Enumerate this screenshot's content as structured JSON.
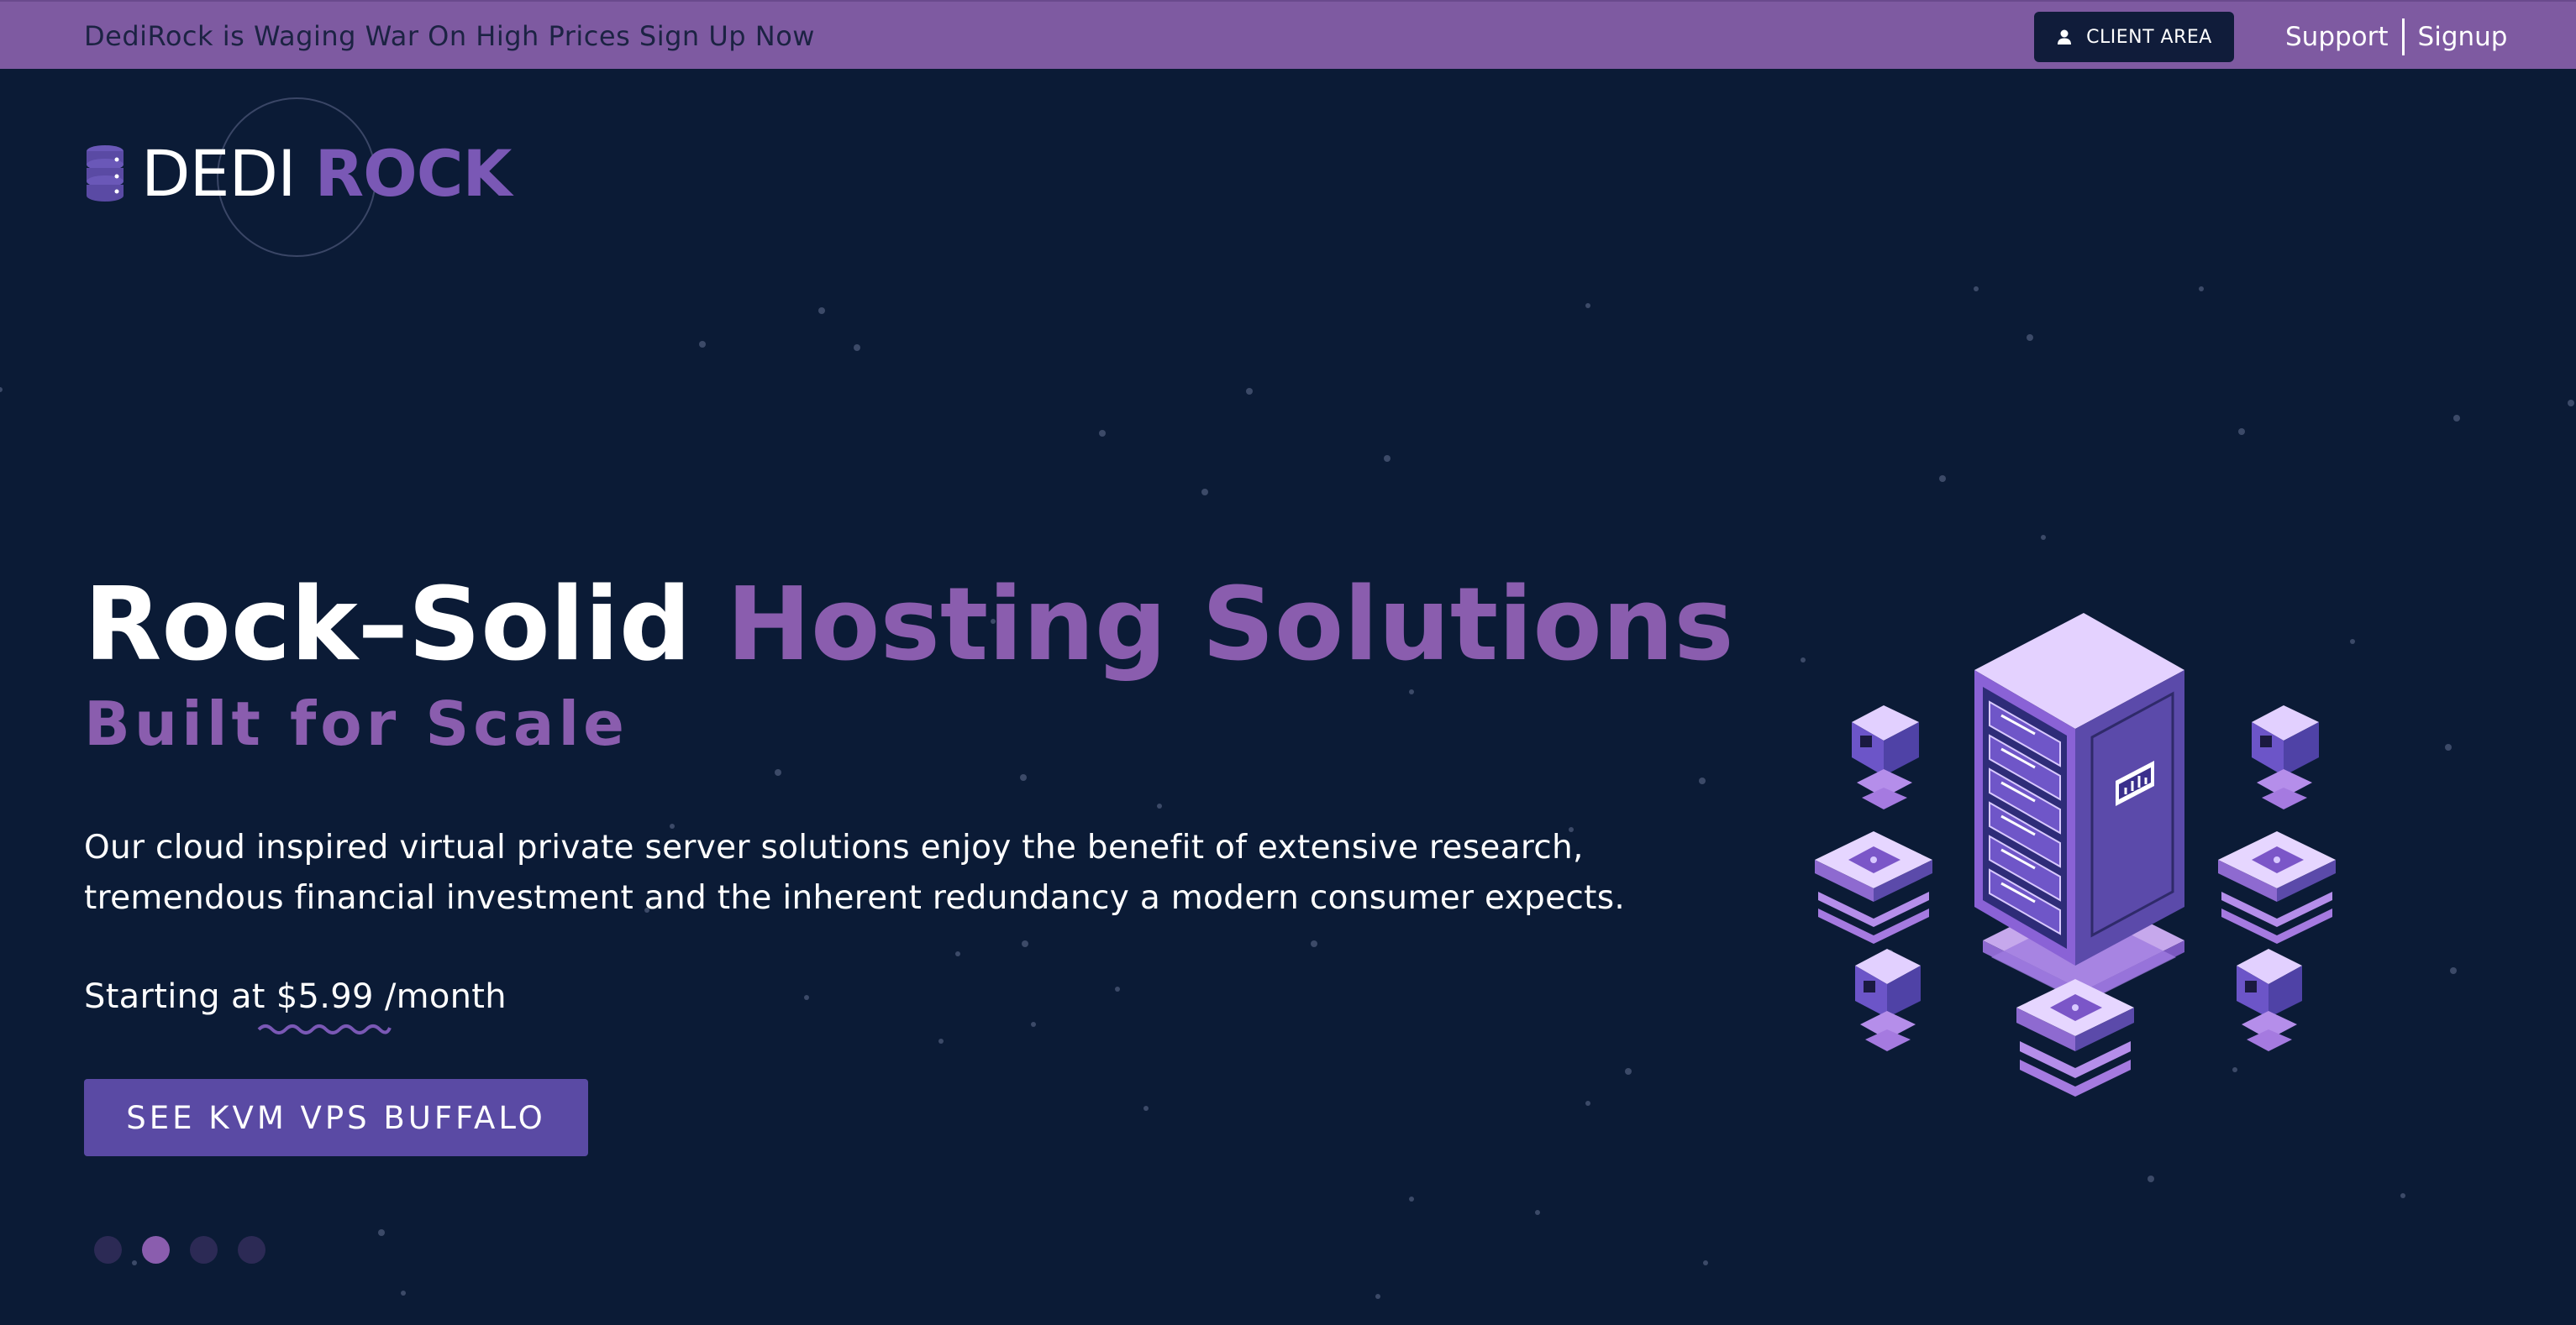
{
  "topbar": {
    "promo": "DediRock is Waging War On High Prices Sign Up Now",
    "client_area": "CLIENT AREA",
    "support": "Support",
    "signup": "Signup"
  },
  "logo": {
    "word1": "DEDI",
    "word2": "ROCK"
  },
  "hero": {
    "title_white": "Rock–Solid",
    "title_purple": "Hosting Solutions",
    "subtitle": "Built for Scale",
    "description": "Our cloud inspired virtual private server solutions enjoy the benefit of extensive research, tremendous financial investment and the inherent redundancy a modern consumer expects.",
    "price_prefix": "Starting at",
    "price": "$5.99",
    "price_suffix": "/month",
    "cta": "SEE KVM VPS BUFFALO"
  },
  "slider": {
    "slides": 4,
    "active_index": 1
  },
  "colors": {
    "background": "#0b1b36",
    "topbar": "#7e5aa1",
    "accent_purple": "#8a5dae",
    "button": "#5a4aa4",
    "client_button": "#101c3a"
  },
  "icons": {
    "client_area": "user-icon",
    "logo": "database-icon",
    "illustration": "server-rack-isometric"
  }
}
